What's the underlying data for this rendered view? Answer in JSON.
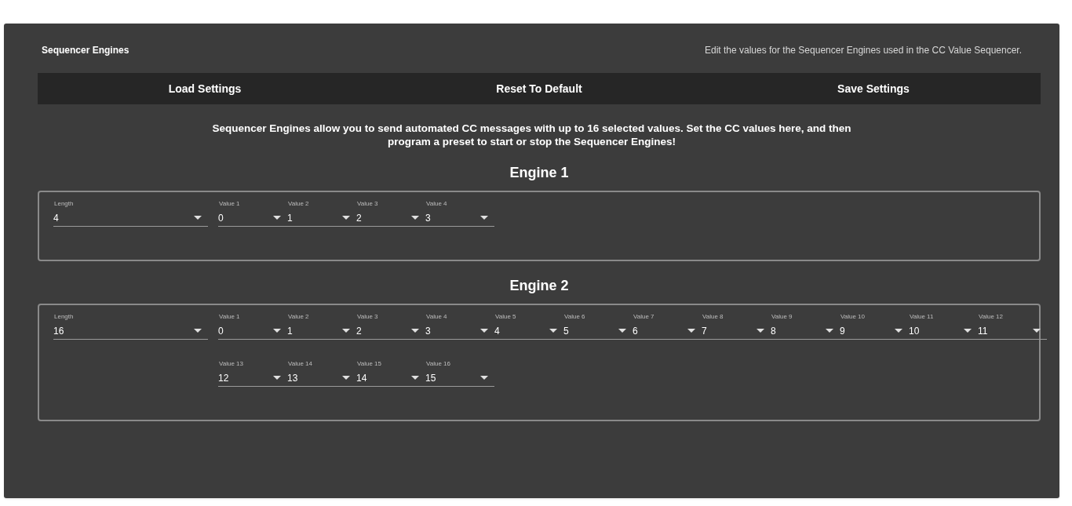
{
  "panel": {
    "title": "Sequencer Engines",
    "subtitle": "Edit the values for the Sequencer Engines used in the CC Value Sequencer."
  },
  "buttons": [
    "Load Settings",
    "Reset To Default",
    "Save Settings"
  ],
  "intro": "Sequencer Engines allow you to send automated CC messages with up to 16 selected values. Set the CC values here, and then program a preset to start or stop the Sequencer Engines!",
  "engines": [
    {
      "title": "Engine 1",
      "length": {
        "label": "Length",
        "value": "4"
      },
      "values": [
        {
          "label": "Value 1",
          "value": "0"
        },
        {
          "label": "Value 2",
          "value": "1"
        },
        {
          "label": "Value 3",
          "value": "2"
        },
        {
          "label": "Value 4",
          "value": "3"
        }
      ]
    },
    {
      "title": "Engine 2",
      "length": {
        "label": "Length",
        "value": "16"
      },
      "values": [
        {
          "label": "Value 1",
          "value": "0"
        },
        {
          "label": "Value 2",
          "value": "1"
        },
        {
          "label": "Value 3",
          "value": "2"
        },
        {
          "label": "Value 4",
          "value": "3"
        },
        {
          "label": "Value 5",
          "value": "4"
        },
        {
          "label": "Value 6",
          "value": "5"
        },
        {
          "label": "Value 7",
          "value": "6"
        },
        {
          "label": "Value 8",
          "value": "7"
        },
        {
          "label": "Value 9",
          "value": "8"
        },
        {
          "label": "Value 10",
          "value": "9"
        },
        {
          "label": "Value 11",
          "value": "10"
        },
        {
          "label": "Value 12",
          "value": "11"
        },
        {
          "label": "Value 13",
          "value": "12"
        },
        {
          "label": "Value 14",
          "value": "13"
        },
        {
          "label": "Value 15",
          "value": "14"
        },
        {
          "label": "Value 16",
          "value": "15"
        }
      ]
    }
  ]
}
